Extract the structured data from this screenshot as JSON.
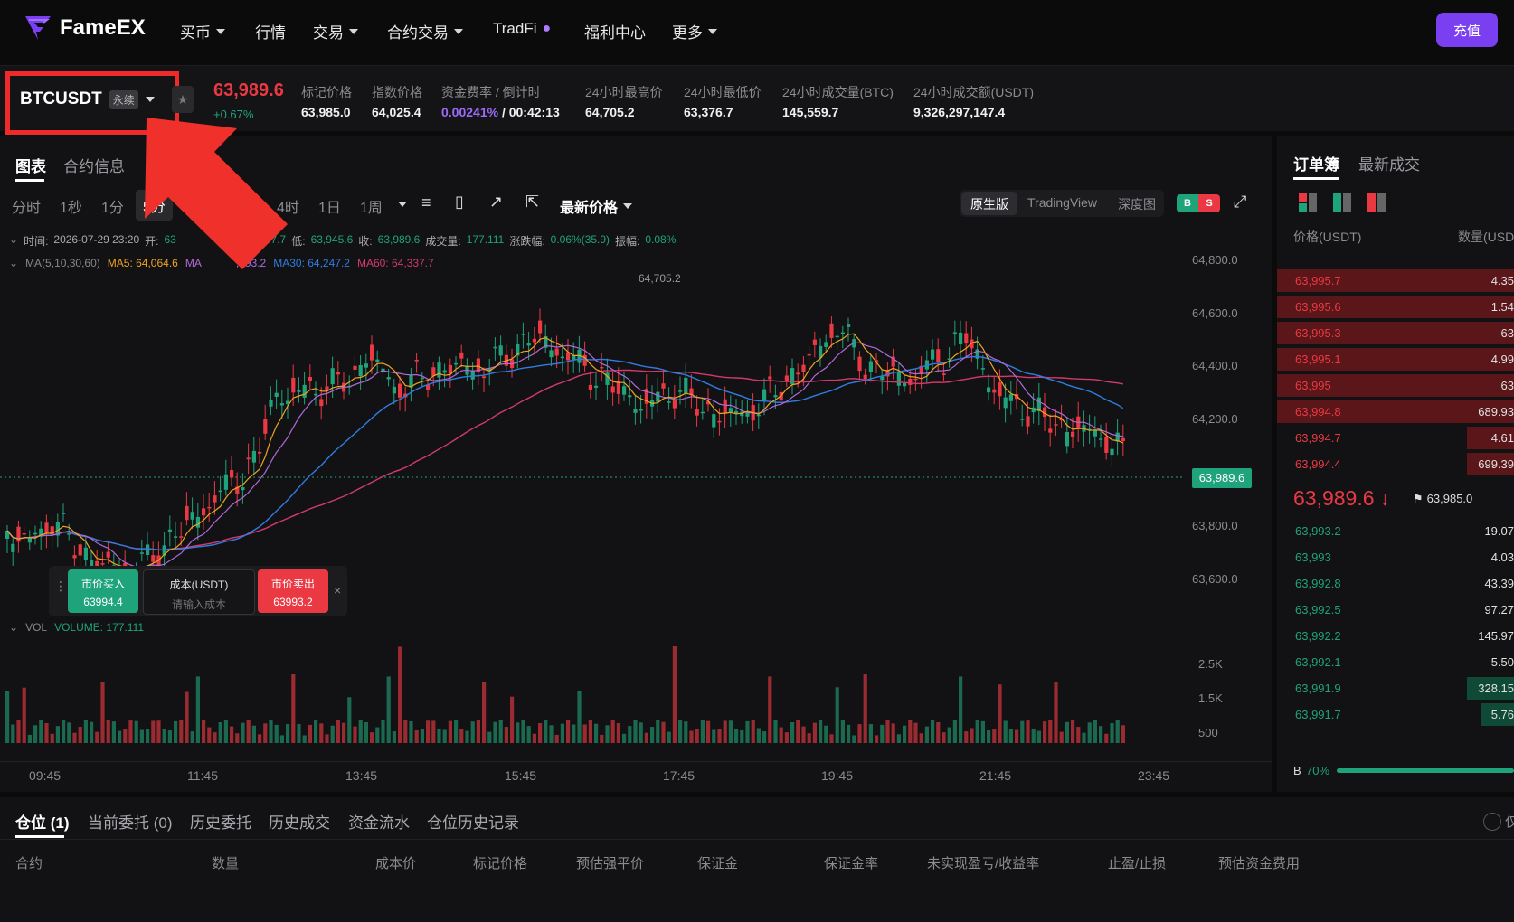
{
  "nav": {
    "logo": "FameEX",
    "items": [
      "买币",
      "行情",
      "交易",
      "合约交易",
      "TradFi",
      "福利中心",
      "更多"
    ],
    "deposit": "充值"
  },
  "ticker": {
    "symbol": "BTCUSDT",
    "badge": "永续",
    "price": "63,989.6",
    "change": "+0.67%",
    "stats": [
      {
        "label": "标记价格",
        "value": "63,985.0"
      },
      {
        "label": "指数价格",
        "value": "64,025.4"
      },
      {
        "label": "资金费率 / 倒计时",
        "value": "0.00241%",
        "value2": " / 00:42:13"
      },
      {
        "label": "24小时最高价",
        "value": "64,705.2"
      },
      {
        "label": "24小时最低价",
        "value": "63,376.7"
      },
      {
        "label": "24小时成交量(BTC)",
        "value": "145,559.7"
      },
      {
        "label": "24小时成交额(USDT)",
        "value": "9,326,297,147.4"
      }
    ]
  },
  "chart": {
    "tabs": [
      "图表",
      "合约信息"
    ],
    "timeframes": [
      "分时",
      "1秒",
      "1分",
      "5分",
      "4时",
      "1日",
      "1周"
    ],
    "price_type": "最新价格",
    "views": [
      "原生版",
      "TradingView",
      "深度图"
    ],
    "bs_badge": "B",
    "bs_badge2": "S",
    "ohlc": {
      "time_label": "时间:",
      "time": "2026-07-29 23:20",
      "open_label": "开:",
      "open": "63",
      "high": ",997.7",
      "low_label": "低:",
      "low": "63,945.6",
      "close_label": "收:",
      "close": "63,989.6",
      "vol_label": "成交量:",
      "vol": "177.111",
      "chg_label": "涨跌幅:",
      "chg": "0.06%(35.9)",
      "amp_label": "振幅:",
      "amp": "0.08%"
    },
    "ma": {
      "label": "MA(5,10,30,60)",
      "ma5": "MA5: 64,064.6",
      "ma10": "MA",
      "ma10v": ",093.2",
      "ma30": "MA30: 64,247.2",
      "ma60": "MA60: 64,337.7"
    },
    "high_marker": "64,705.2",
    "price_axis": [
      "64,800.0",
      "64,600.0",
      "64,400.0",
      "64,200.0",
      "63,800.0",
      "63,600.0"
    ],
    "current_price_tag": "63,989.6",
    "vol_label": "VOL",
    "vol_value": "VOLUME: 177.111",
    "vol_axis": [
      "2.5K",
      "1.5K",
      "500"
    ],
    "time_axis": [
      "09:45",
      "11:45",
      "13:45",
      "15:45",
      "17:45",
      "19:45",
      "21:45",
      "23:45"
    ],
    "quick_trade": {
      "buy": "市价买入",
      "buy_price": "63994.4",
      "cost": "成本(USDT)",
      "cost_ph": "请输入成本",
      "sell": "市价卖出",
      "sell_price": "63993.2"
    },
    "colors": {
      "up": "#1fa37a",
      "down": "#ea3943",
      "ma5": "#f0a321",
      "ma10": "#b06ad9",
      "ma30": "#2f7de1",
      "ma60": "#d33a6b"
    }
  },
  "orderbook": {
    "tabs": [
      "订单簿",
      "最新成交"
    ],
    "head_price": "价格(USDT)",
    "head_qty": "数量(USD",
    "asks": [
      {
        "p": "63,995.7",
        "q": "4.35",
        "w": 1.0
      },
      {
        "p": "63,995.6",
        "q": "1.54",
        "w": 1.0
      },
      {
        "p": "63,995.3",
        "q": "63",
        "w": 1.0
      },
      {
        "p": "63,995.1",
        "q": "4.99",
        "w": 1.0
      },
      {
        "p": "63,995",
        "q": "63",
        "w": 1.0
      },
      {
        "p": "63,994.8",
        "q": "689.93",
        "w": 1.0
      },
      {
        "p": "63,994.7",
        "q": "4.61",
        "w": 0.2
      },
      {
        "p": "63,994.4",
        "q": "699.39",
        "w": 0.2
      }
    ],
    "last": "63,989.6",
    "arrow": "↓",
    "mark": "63,985.0",
    "bids": [
      {
        "p": "63,993.2",
        "q": "19.07",
        "w": 0
      },
      {
        "p": "63,993",
        "q": "4.03",
        "w": 0
      },
      {
        "p": "63,992.8",
        "q": "43.39",
        "w": 0
      },
      {
        "p": "63,992.5",
        "q": "97.27",
        "w": 0
      },
      {
        "p": "63,992.2",
        "q": "145.97",
        "w": 0
      },
      {
        "p": "63,992.1",
        "q": "5.50",
        "w": 0
      },
      {
        "p": "63,991.9",
        "q": "328.15",
        "w": 0.2
      },
      {
        "p": "63,991.7",
        "q": "5.76",
        "w": 0.14
      }
    ],
    "ratio_b": "B",
    "ratio": "70%"
  },
  "bottom": {
    "tabs": [
      "仓位 (1)",
      "当前委托 (0)",
      "历史委托",
      "历史成交",
      "资金流水",
      "仓位历史记录"
    ],
    "only": "仅",
    "columns": [
      "合约",
      "数量",
      "成本价",
      "标记价格",
      "预估强平价",
      "保证金",
      "保证金率",
      "未实现盈亏/收益率",
      "止盈/止损",
      "预估资金费用"
    ]
  }
}
